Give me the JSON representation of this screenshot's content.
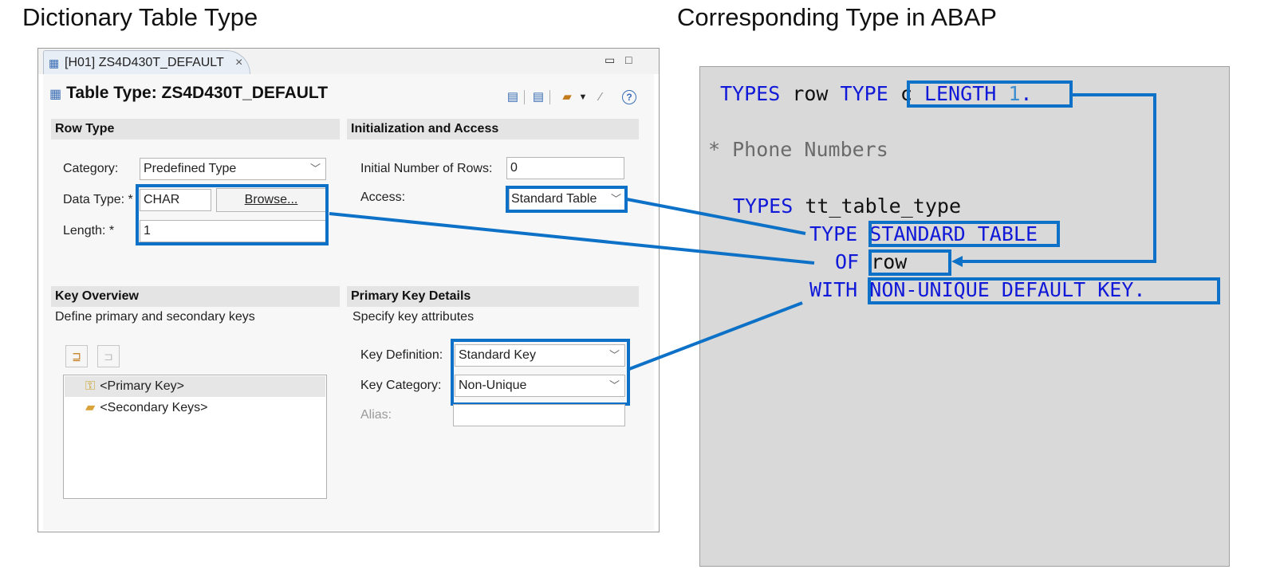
{
  "headings": {
    "left": "Dictionary Table Type",
    "right": "Corresponding Type in ABAP"
  },
  "window": {
    "tab_label": "[H01] ZS4D430T_DEFAULT",
    "tab_close": "×",
    "minimize": "▭",
    "maximize": "□",
    "editor_title": "Table Type: ZS4D430T_DEFAULT"
  },
  "row_type": {
    "section": "Row Type",
    "category_label": "Category:",
    "category_value": "Predefined Type",
    "data_type_label": "Data Type: *",
    "data_type_value": "CHAR",
    "browse_label": "Browse...",
    "length_label": "Length: *",
    "length_value": "1"
  },
  "init_access": {
    "section": "Initialization and Access",
    "initial_rows_label": "Initial Number of Rows:",
    "initial_rows_value": "0",
    "access_label": "Access:",
    "access_value": "Standard Table"
  },
  "key_overview": {
    "section": "Key Overview",
    "description": "Define primary and secondary keys",
    "items": [
      "<Primary Key>",
      "<Secondary Keys>"
    ]
  },
  "primary_key": {
    "section": "Primary Key Details",
    "description": "Specify key attributes",
    "key_definition_label": "Key Definition:",
    "key_definition_value": "Standard Key",
    "key_category_label": "Key Category:",
    "key_category_value": "Non-Unique",
    "alias_label": "Alias:",
    "alias_value": ""
  },
  "code": {
    "line1": {
      "kw1": "TYPES",
      "id1": "row",
      "kw2": "TYPE",
      "id2": "c",
      "kw3": "LENGTH",
      "num": "1",
      "dot": "."
    },
    "comment": "* Phone Numbers",
    "line3": {
      "kw": "TYPES",
      "id": "tt_table_type"
    },
    "line4": {
      "kw": "TYPE",
      "kw2": "STANDARD TABLE"
    },
    "line5": {
      "kw": "OF",
      "id": "row"
    },
    "line6": {
      "kw": "WITH",
      "kw2": "NON-UNIQUE DEFAULT KEY."
    }
  },
  "colors": {
    "highlight": "#0d72c7",
    "keyword": "#1019d8",
    "number": "#3d8ed0",
    "comment": "#6b6b6b",
    "code_bg": "#d9d9d9"
  },
  "icons": [
    "table-type-icon",
    "close-icon",
    "minimize-icon",
    "maximize-icon",
    "key-icon",
    "folder-icon",
    "add-key-icon",
    "remove-key-icon",
    "help-icon"
  ]
}
